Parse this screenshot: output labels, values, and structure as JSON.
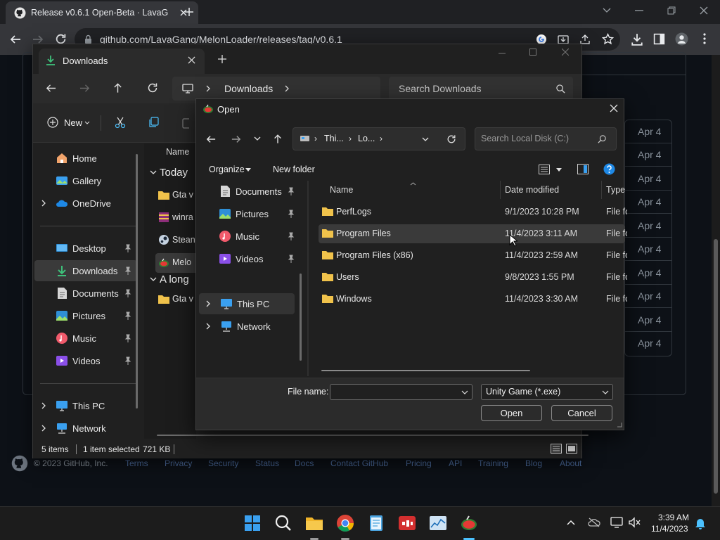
{
  "browser": {
    "tab_title": "Release v0.6.1 Open-Beta · LavaG",
    "url": "github.com/LavaGang/MelonLoader/releases/tag/v0.6.1"
  },
  "github_page": {
    "dates": [
      "Apr 4",
      "Apr 4",
      "Apr 4",
      "Apr 4",
      "Apr 4",
      "Apr 4",
      "Apr 4",
      "Apr 4",
      "Apr 4",
      "Apr 4"
    ],
    "footer": {
      "copyright": "© 2023 GitHub, Inc.",
      "links": [
        "Terms",
        "Privacy",
        "Security",
        "Status",
        "Docs",
        "Contact GitHub",
        "Pricing",
        "API",
        "Training",
        "Blog",
        "About"
      ]
    }
  },
  "explorer": {
    "tab_title": "Downloads",
    "breadcrumb": "Downloads",
    "search_placeholder": "Search Downloads",
    "new_label": "New",
    "nav": {
      "home": "Home",
      "gallery": "Gallery",
      "onedrive": "OneDrive",
      "desktop": "Desktop",
      "downloads": "Downloads",
      "documents": "Documents",
      "pictures": "Pictures",
      "music": "Music",
      "videos": "Videos",
      "this_pc": "This PC",
      "network": "Network"
    },
    "column_name": "Name",
    "groups": [
      {
        "label": "Today",
        "items": [
          "Gta v",
          "winra",
          "Stean",
          "Melo"
        ]
      },
      {
        "label": "A long",
        "items": [
          "Gta v"
        ]
      }
    ],
    "status": {
      "items": "5 items",
      "selected": "1 item selected",
      "size": "721 KB"
    }
  },
  "dialog": {
    "title": "Open",
    "address": {
      "part1": "Thi...",
      "part2": "Lo..."
    },
    "search_placeholder": "Search Local Disk (C:)",
    "organize_label": "Organize",
    "new_folder_label": "New folder",
    "nav": {
      "documents": "Documents",
      "pictures": "Pictures",
      "music": "Music",
      "videos": "Videos",
      "this_pc": "This PC",
      "network": "Network"
    },
    "columns": {
      "name": "Name",
      "date": "Date modified",
      "type": "Type"
    },
    "files": [
      {
        "name": "PerfLogs",
        "date": "9/1/2023 10:28 PM",
        "type": "File fo"
      },
      {
        "name": "Program Files",
        "date": "11/4/2023 3:11 AM",
        "type": "File fo"
      },
      {
        "name": "Program Files (x86)",
        "date": "11/4/2023 2:59 AM",
        "type": "File fo"
      },
      {
        "name": "Users",
        "date": "9/8/2023 1:55 PM",
        "type": "File fo"
      },
      {
        "name": "Windows",
        "date": "11/4/2023 3:30 AM",
        "type": "File fo"
      }
    ],
    "file_name_label": "File name:",
    "file_name_value": "",
    "filter": "Unity Game (*.exe)",
    "open_label": "Open",
    "cancel_label": "Cancel"
  },
  "taskbar": {
    "time": "3:39 AM",
    "date": "11/4/2023"
  },
  "colors": {
    "accent": "#4cc2ff",
    "folder": "#f0c24b",
    "selection": "#3a3a3a"
  }
}
